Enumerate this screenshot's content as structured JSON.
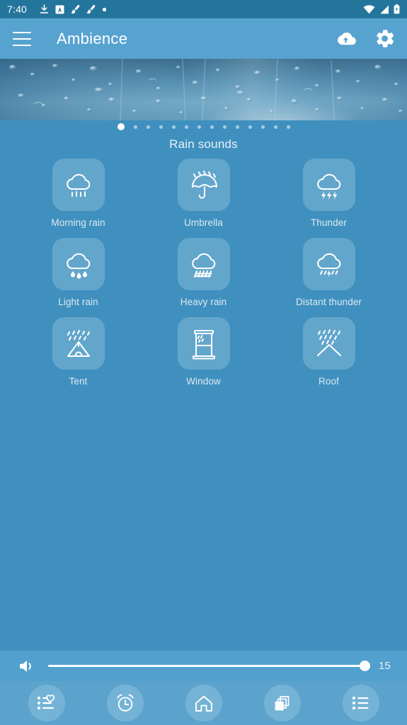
{
  "status_bar": {
    "clock": "7:40",
    "left_icons": [
      "download-icon",
      "app-a-icon",
      "brush-icon",
      "brush-icon",
      "dot-icon"
    ],
    "right_icons": [
      "wifi-icon",
      "cell-signal-icon",
      "battery-icon"
    ]
  },
  "app_bar": {
    "menu_icon": "hamburger-menu-icon",
    "title": "Ambience",
    "actions": [
      {
        "name": "cloud-upload-icon"
      },
      {
        "name": "settings-gear-icon"
      }
    ]
  },
  "hero": {
    "alt": "rain drops on window glass",
    "pager": {
      "total": 14,
      "active_index": 0
    }
  },
  "section": {
    "title": "Rain sounds"
  },
  "sounds": [
    {
      "label": "Morning rain",
      "icon": "cloud-drizzle-icon"
    },
    {
      "label": "Umbrella",
      "icon": "umbrella-rain-icon"
    },
    {
      "label": "Thunder",
      "icon": "cloud-lightning-icon"
    },
    {
      "label": "Light rain",
      "icon": "cloud-droplets-icon"
    },
    {
      "label": "Heavy rain",
      "icon": "cloud-heavy-rain-icon"
    },
    {
      "label": "Distant thunder",
      "icon": "cloud-small-lightning-icon"
    },
    {
      "label": "Tent",
      "icon": "tent-rain-icon"
    },
    {
      "label": "Window",
      "icon": "window-rain-icon"
    },
    {
      "label": "Roof",
      "icon": "roof-rain-icon"
    }
  ],
  "volume": {
    "icon": "speaker-volume-icon",
    "value": "15",
    "percent": 100
  },
  "bottom_nav": [
    {
      "name": "favorites-list-icon",
      "label": "Favorites"
    },
    {
      "name": "alarm-clock-icon",
      "label": "Timer"
    },
    {
      "name": "home-icon",
      "label": "Home"
    },
    {
      "name": "layers-icon",
      "label": "Mixes"
    },
    {
      "name": "list-icon",
      "label": "Playlist"
    }
  ],
  "colors": {
    "status_bar": "#24759C",
    "app_bar": "#57A3D0",
    "page_background": "#3F90BE",
    "tile": "#63A6CC",
    "nav_bar": "#5BA3CD",
    "nav_circle": "#74B3D6",
    "accent_text": "#FFFFFF"
  }
}
